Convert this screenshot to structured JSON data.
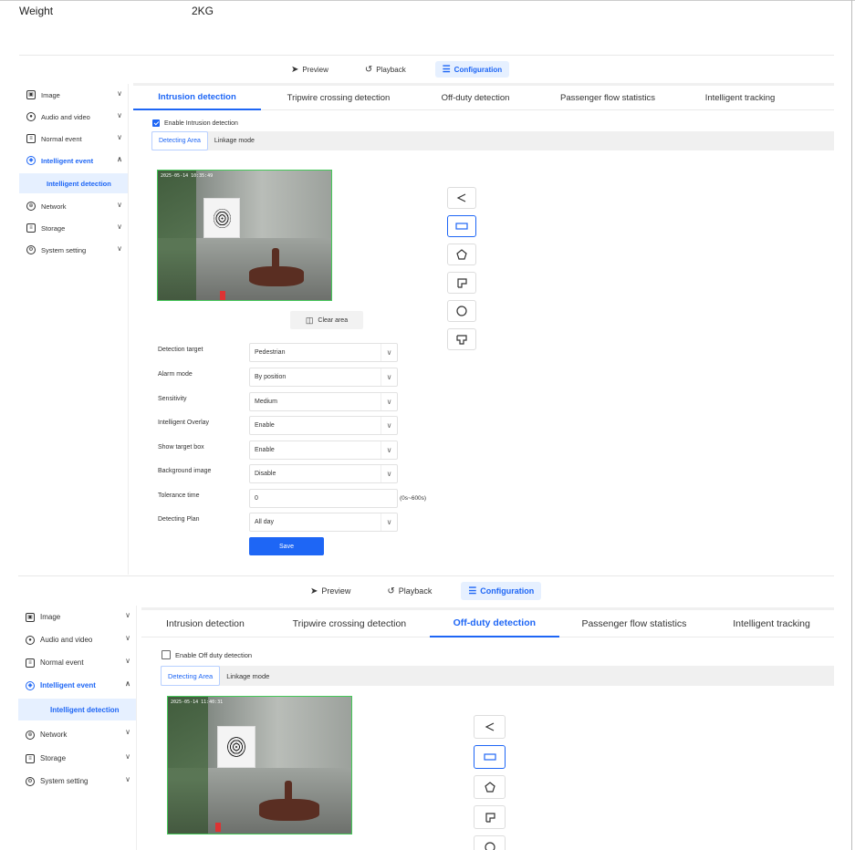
{
  "spec": {
    "key": "Weight",
    "value": "2KG"
  },
  "topnav": {
    "preview": "Preview",
    "playback": "Playback",
    "configuration": "Configuration"
  },
  "sidebar": {
    "items": [
      {
        "label": "Image"
      },
      {
        "label": "Audio and video"
      },
      {
        "label": "Normal event"
      },
      {
        "label": "Intelligent event"
      },
      {
        "label": "Network"
      },
      {
        "label": "Storage"
      },
      {
        "label": "System setting"
      }
    ],
    "sub_item": "Intelligent detection"
  },
  "tabs": [
    "Intrusion detection",
    "Tripwire crossing detection",
    "Off-duty detection",
    "Passenger flow statistics",
    "Intelligent tracking"
  ],
  "panel1": {
    "enable_label": "Enable Intrusion detection",
    "enable_checked": true,
    "subtabs": [
      "Detecting Area",
      "Linkage mode"
    ],
    "video_timestamp": "2025-05-14 10:35:49",
    "clear_area": "Clear area",
    "form": [
      {
        "label": "Detection target",
        "value": "Pedestrian"
      },
      {
        "label": "Alarm mode",
        "value": "By position"
      },
      {
        "label": "Sensitivity",
        "value": "Medium"
      },
      {
        "label": "Intelligent Overlay",
        "value": "Enable"
      },
      {
        "label": "Show target box",
        "value": "Enable"
      },
      {
        "label": "Background image",
        "value": "Disable"
      },
      {
        "label": "Tolerance time",
        "value": "0",
        "unit": "(0s~600s)"
      },
      {
        "label": "Detecting Plan",
        "value": "All day"
      }
    ],
    "save": "Save"
  },
  "panel2": {
    "enable_label": "Enable Off duty detection",
    "enable_checked": false,
    "subtabs": [
      "Detecting Area",
      "Linkage mode"
    ],
    "video_timestamp": "2025-05-14 11:40:31"
  },
  "colors": {
    "accent": "#1e66f5",
    "accent_light": "#e6f0ff",
    "video_border": "#46c85a"
  },
  "icons": {
    "preview": "preview-icon",
    "playback": "playback-icon",
    "configuration": "sliders-icon",
    "shapes": [
      "triangle-icon",
      "rectangle-icon",
      "pentagon-icon",
      "l-shape-icon",
      "circle-icon",
      "t-shape-icon"
    ]
  }
}
